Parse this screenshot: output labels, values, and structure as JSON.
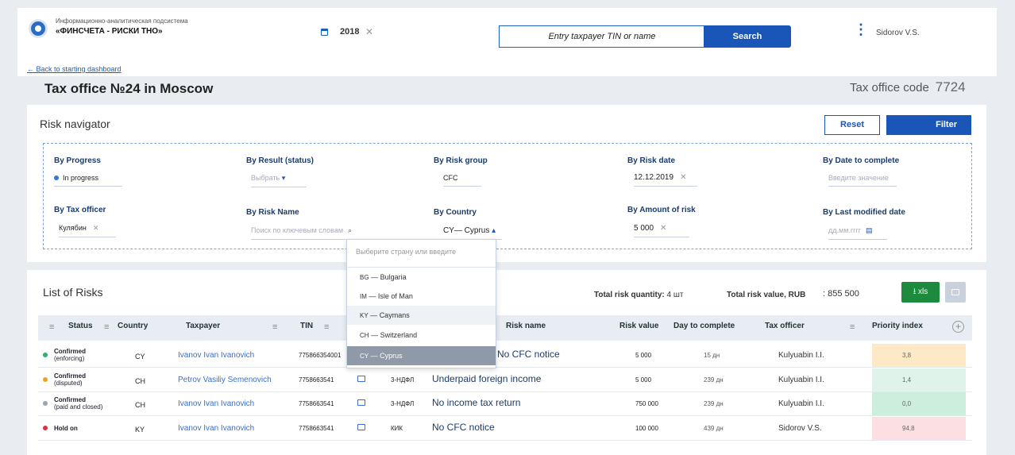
{
  "header": {
    "subtitle": "Информационно-аналитическая подсистема",
    "brand": "«ФИНСЧЕТА - РИСКИ ТНО»",
    "year": "2018",
    "year_clear": "✕",
    "search_placeholder": "Entry taxpayer TIN or name",
    "search_button": "Search",
    "menu": "⋮",
    "user": "Sidorov V.S."
  },
  "page": {
    "back": "← Back to starting dashboard",
    "title": "Tax office №24 in Moscow",
    "code_label": "Tax office code",
    "code": "7724"
  },
  "navigator": {
    "title": "Risk navigator",
    "reset": "Reset",
    "filter": "Filter",
    "filters": {
      "progress": {
        "label": "By Progress",
        "value": "In progress"
      },
      "result": {
        "label": "By Result (status)",
        "value": "Выбрать",
        "arrow": "▾"
      },
      "group": {
        "label": "By Risk group",
        "value": "CFC"
      },
      "date": {
        "label": "By Risk date",
        "value": "12.12.2019"
      },
      "complete": {
        "label": "By Date to complete",
        "value": "Введите значение"
      },
      "officer": {
        "label": "By Tax officer",
        "value": "Кулябин"
      },
      "name": {
        "label": "By Risk Name",
        "value": "Поиск по ключевым словам"
      },
      "country": {
        "label": "By Country",
        "value": "CY— Cyprus",
        "arrow": "▴"
      },
      "amount": {
        "label": "By Amount of risk",
        "value": "5 000"
      },
      "modified": {
        "label": "By Last modified date",
        "value": "дд.мм.гггг"
      }
    }
  },
  "dropdown": {
    "placeholder": "Выберите страну или введите",
    "items": [
      {
        "code": "BG",
        "name": "Bulgaria"
      },
      {
        "code": "IM",
        "name": "Isle of Man"
      },
      {
        "code": "KY",
        "name": "Caymans"
      },
      {
        "code": "CH",
        "name": "Switzerland"
      },
      {
        "code": "CY",
        "name": "Cyprus"
      }
    ],
    "sep": " — "
  },
  "list": {
    "title": "List of Risks",
    "qty_label": "Total risk quantity:",
    "qty_value": "4 шт",
    "value_label": "Total risk value, RUB",
    "value": ": 855 500",
    "xls": "⭳ xls",
    "columns": {
      "status": "Status",
      "country": "Country",
      "taxpayer": "Taxpayer",
      "tin": "TIN",
      "risk_name": "Risk name",
      "risk_value": "Risk value",
      "days": "Day to complete",
      "officer": "Tax officer",
      "priority": "Priority index"
    },
    "rows": [
      {
        "status": "Confirmed",
        "sub": "(enforcing)",
        "color": "#2db36a",
        "country": "CY",
        "taxpayer": "Ivanov Ivan Ivanovich",
        "tin": "775866354001",
        "type": "",
        "name": "No CFC notice",
        "value": "5 000",
        "days": "15 дн",
        "officer": "Kulyuabin I.I.",
        "priority": "3,8",
        "pcolor": "#fde9c6"
      },
      {
        "status": "Confirmed",
        "sub": "(disputed)",
        "color": "#f0a020",
        "country": "CH",
        "taxpayer": "Petrov Vasiliy Semenovich",
        "tin": "7758663541",
        "type": "3-НДФЛ",
        "name": "Underpaid foreign income",
        "value": "5 000",
        "days": "239 дн",
        "officer": "Kulyuabin I.I.",
        "priority": "1,4",
        "pcolor": "#dff3ea"
      },
      {
        "status": "Confirmed",
        "sub": "(paid and closed)",
        "color": "#9aa4b0",
        "country": "CH",
        "taxpayer": "Ivanov Ivan Ivanovich",
        "tin": "7758663541",
        "type": "3-НДФЛ",
        "name": "No income tax return",
        "value": "750 000",
        "days": "239 дн",
        "officer": "Kulyuabin I.I.",
        "priority": "0,0",
        "pcolor": "#cdeedd"
      },
      {
        "status": "Hold on",
        "sub": "",
        "color": "#e03040",
        "country": "KY",
        "taxpayer": "Ivanov Ivan Ivanovich",
        "tin": "7758663541",
        "type": "КИК",
        "name": "No CFC notice",
        "value": "100 000",
        "days": "439 дн",
        "officer": "Sidorov V.S.",
        "priority": "94,8",
        "pcolor": "#fbdfe3"
      }
    ]
  }
}
